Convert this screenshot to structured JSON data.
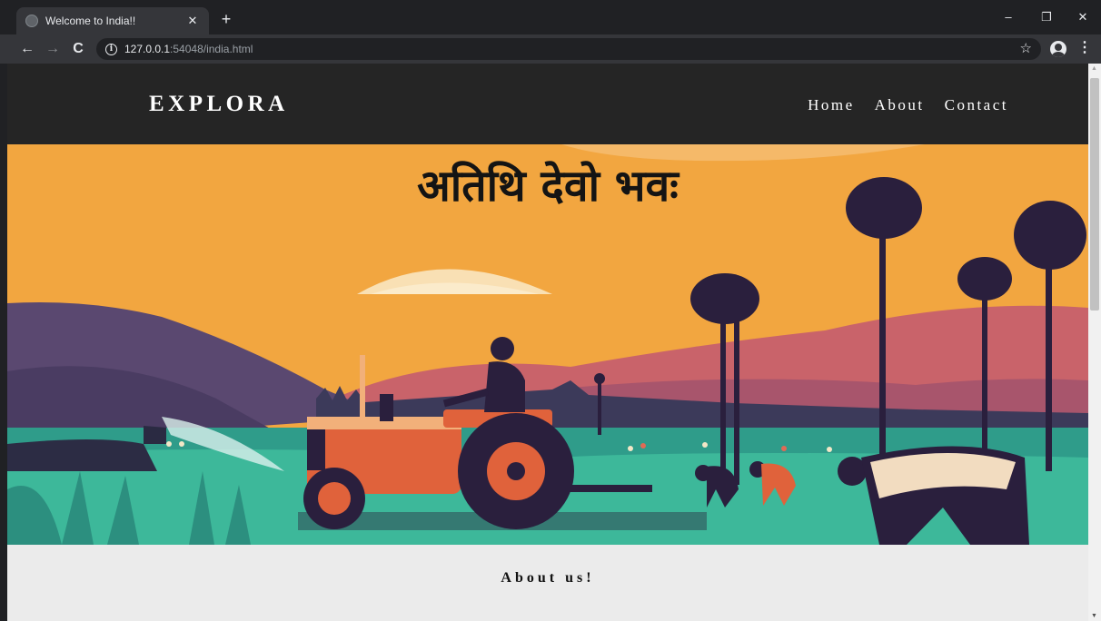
{
  "browser": {
    "tab_title": "Welcome to India!!",
    "tab_close": "✕",
    "new_tab": "+",
    "url_host": "127.0.0.1",
    "url_rest": ":54048/india.html",
    "controls": {
      "minimize": "–",
      "restore": "❐",
      "close": "✕"
    },
    "nav": {
      "back": "←",
      "forward": "→",
      "reload": "C"
    },
    "bookmark_star": "☆",
    "menu": "⋮"
  },
  "site": {
    "brand": "EXPLORA",
    "nav_links": [
      "Home",
      "About",
      "Contact"
    ],
    "hero_title": "अतिथि देवो भवः",
    "about_heading": "About us!"
  },
  "colors": {
    "nav_background": "#252525",
    "sky": "#f2a640",
    "field": "#3db89a",
    "about_background": "#ebebeb"
  }
}
